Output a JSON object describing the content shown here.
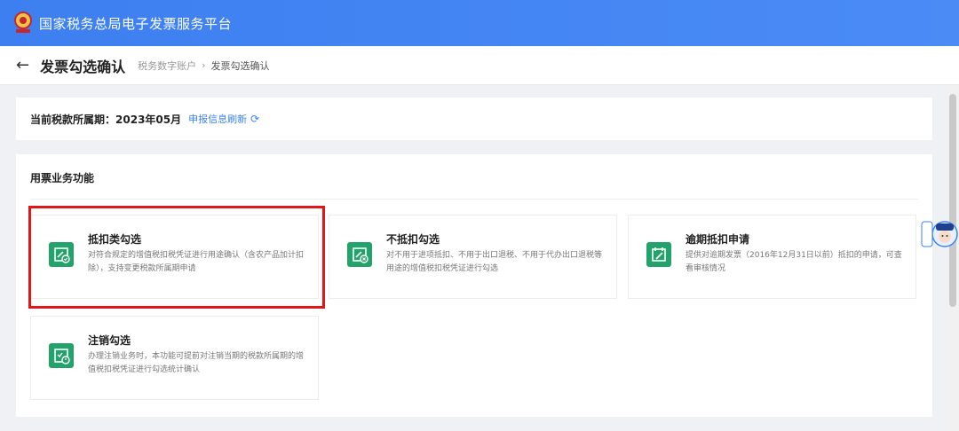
{
  "app": {
    "title": "国家税务总局电子发票服务平台"
  },
  "header": {
    "page_title": "发票勾选确认",
    "breadcrumb": [
      "税务数字账户",
      "发票勾选确认"
    ],
    "breadcrumb_sep": "›"
  },
  "period": {
    "label": "当前税款所属期：",
    "value": "2023年05月",
    "refresh_label": "申报信息刷新"
  },
  "functions": {
    "title": "用票业务功能",
    "cards": [
      {
        "title": "抵扣类勾选",
        "desc": "对符合规定的增值税扣税凭证进行用途确认（含农产品加计扣除），支持变更税款所属期申请"
      },
      {
        "title": "不抵扣勾选",
        "desc": "对不用于进项抵扣、不用于出口退税、不用于代办出口退税等用途的增值税扣税凭证进行勾选"
      },
      {
        "title": "逾期抵扣申请",
        "desc": "提供对逾期发票（2016年12月31日以前）抵扣的申请，可查看审核情况"
      },
      {
        "title": "注销勾选",
        "desc": "办理注销业务时，本功能可提前对注销当期的税款所属期的增值税扣税凭证进行勾选统计确认"
      }
    ]
  },
  "colors": {
    "topbar": "#3b82f6",
    "icon": "#23a26c",
    "highlight": "#e0161b",
    "link": "#3b82f6"
  }
}
